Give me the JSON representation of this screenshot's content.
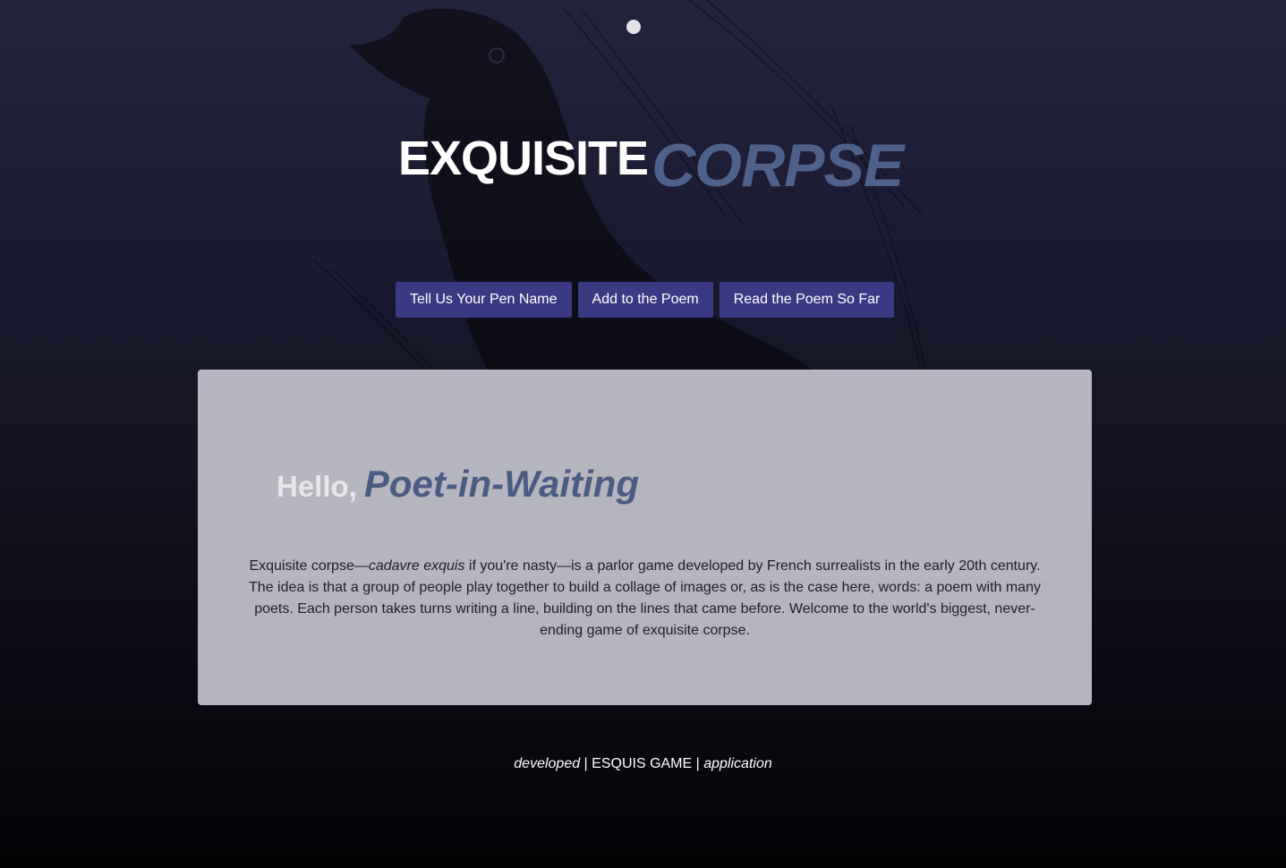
{
  "header": {
    "title_part1": "EXQUISITE",
    "title_part2": "CORPSE"
  },
  "nav": {
    "pen_name_label": "Tell Us Your Pen Name",
    "add_label": "Add to the Poem",
    "read_label": "Read the Poem So Far"
  },
  "card": {
    "greeting": "Hello,",
    "name": "Poet-in-Waiting",
    "desc_part1": "Exquisite corpse—",
    "desc_italic": "cadavre exquis",
    "desc_part2": " if you're nasty—is a parlor game developed by French surrealists in the early 20th century. The idea is that a group of people play together to build a collage of images or, as is the case here, words: a poem with many poets. Each person takes turns writing a line, building on the lines that came before. Welcome to the world's biggest, never-ending game of exquisite corpse."
  },
  "footer": {
    "left": "developed",
    "sep1": " | ",
    "middle": "ESQUIS GAME",
    "sep2": " | ",
    "right": "application"
  },
  "colors": {
    "accent": "#4e6189",
    "button_bg": "#3a3a84",
    "card_bg": "#cdcdd7"
  },
  "icons": {
    "background": "raven-illustration",
    "indicator": "dot-icon"
  }
}
